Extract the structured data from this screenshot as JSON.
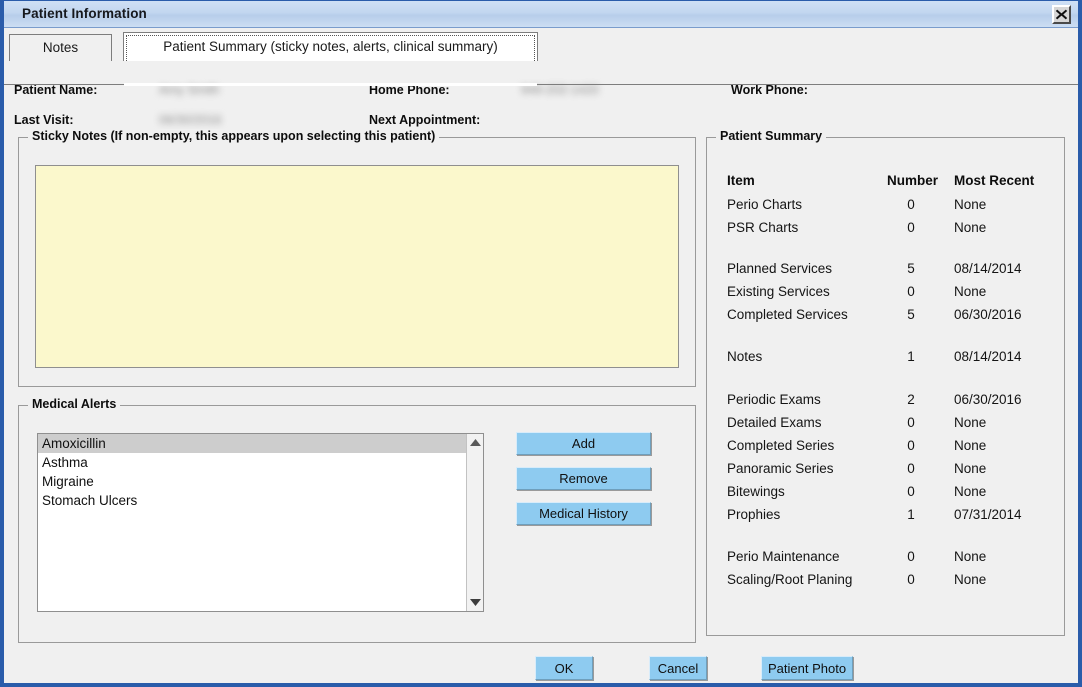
{
  "window": {
    "title": "Patient Information",
    "close_icon": "close-x-icon"
  },
  "tabs": [
    {
      "label": "Notes",
      "active": false
    },
    {
      "label": "Patient Summary (sticky notes, alerts, clinical summary)",
      "active": true
    }
  ],
  "header": {
    "patient_name_label": "Patient Name:",
    "patient_name_value": "Amy Smith",
    "last_visit_label": "Last Visit:",
    "last_visit_value": "06/30/2016",
    "home_phone_label": "Home Phone:",
    "home_phone_value": "949-202-1420",
    "next_appointment_label": "Next Appointment:",
    "next_appointment_value": "",
    "work_phone_label": "Work Phone:",
    "work_phone_value": ""
  },
  "sticky_notes": {
    "group_title": "Sticky Notes (If non-empty, this appears upon selecting this patient)",
    "value": "",
    "placeholder": ""
  },
  "medical_alerts": {
    "group_title": "Medical Alerts",
    "items": [
      {
        "label": "Amoxicillin",
        "selected": true
      },
      {
        "label": "Asthma",
        "selected": false
      },
      {
        "label": "Migraine",
        "selected": false
      },
      {
        "label": "Stomach Ulcers",
        "selected": false
      }
    ],
    "buttons": [
      {
        "label": "Add"
      },
      {
        "label": "Remove"
      },
      {
        "label": "Medical History"
      }
    ],
    "scrollbar": {
      "up_icon": "scroll-up-arrow-icon",
      "down_icon": "scroll-down-arrow-icon"
    }
  },
  "patient_summary": {
    "group_title": "Patient Summary",
    "columns": [
      "Item",
      "Number",
      "Most Recent"
    ],
    "rows": [
      {
        "item": "Perio Charts",
        "number": "0",
        "most_recent": "None",
        "gap_before": false
      },
      {
        "item": "PSR Charts",
        "number": "0",
        "most_recent": "None",
        "gap_before": false
      },
      {
        "item": "Planned Services",
        "number": "5",
        "most_recent": "08/14/2014",
        "gap_before": true
      },
      {
        "item": "Existing Services",
        "number": "0",
        "most_recent": "None",
        "gap_before": false
      },
      {
        "item": "Completed Services",
        "number": "5",
        "most_recent": "06/30/2016",
        "gap_before": false
      },
      {
        "item": "Notes",
        "number": "1",
        "most_recent": "08/14/2014",
        "gap_before": true
      },
      {
        "item": "Periodic Exams",
        "number": "2",
        "most_recent": "06/30/2016",
        "gap_before": true
      },
      {
        "item": "Detailed Exams",
        "number": "0",
        "most_recent": "None",
        "gap_before": false
      },
      {
        "item": "Completed Series",
        "number": "0",
        "most_recent": "None",
        "gap_before": false
      },
      {
        "item": "Panoramic Series",
        "number": "0",
        "most_recent": "None",
        "gap_before": false
      },
      {
        "item": "Bitewings",
        "number": "0",
        "most_recent": "None",
        "gap_before": false
      },
      {
        "item": "Prophies",
        "number": "1",
        "most_recent": "07/31/2014",
        "gap_before": false
      },
      {
        "item": "Perio Maintenance",
        "number": "0",
        "most_recent": "None",
        "gap_before": true
      },
      {
        "item": "Scaling/Root Planing",
        "number": "0",
        "most_recent": "None",
        "gap_before": false
      }
    ]
  },
  "footer": {
    "buttons": [
      {
        "label": "OK",
        "name": "ok-button"
      },
      {
        "label": "Cancel",
        "name": "cancel-button"
      },
      {
        "label": "Patient Photo",
        "name": "patient-photo-button"
      }
    ]
  },
  "colors": {
    "titlebar_blue": "#c2d6ef",
    "window_border_blue": "#2a5caa",
    "button_blue": "#8ecbf0",
    "sticky_yellow": "#fbf8cc",
    "selection_gray": "#cdcdcd",
    "dialog_gray": "#f0f0f0"
  }
}
